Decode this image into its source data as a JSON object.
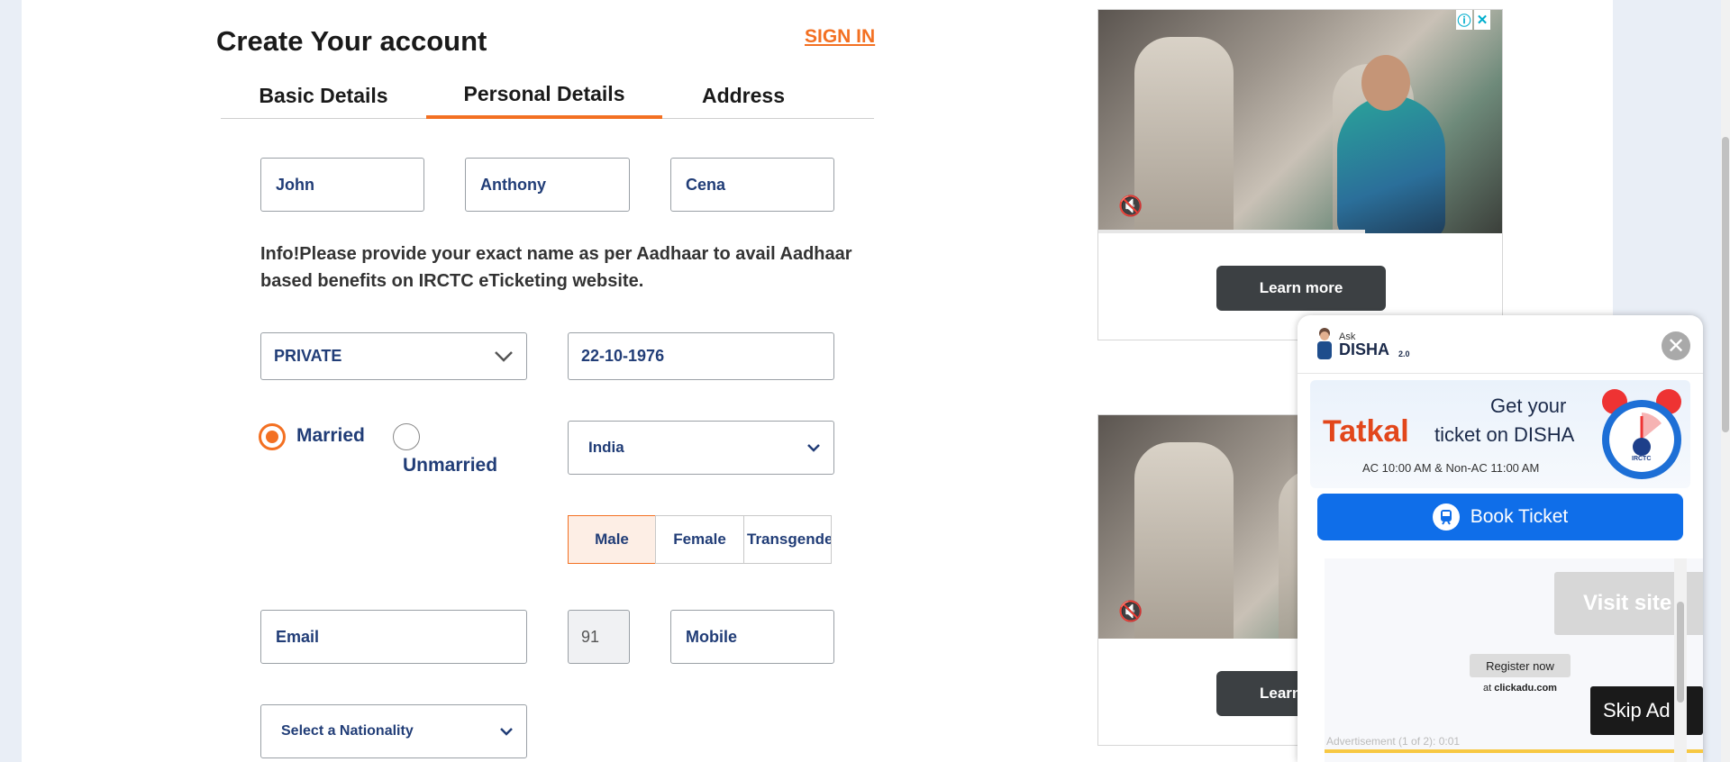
{
  "header": {
    "title": "Create Your account",
    "signin_label": "SIGN IN"
  },
  "tabs": [
    {
      "label": "Basic Details",
      "active": false
    },
    {
      "label": "Personal Details",
      "active": true
    },
    {
      "label": "Address",
      "active": false
    }
  ],
  "name": {
    "first": "John",
    "middle": "Anthony",
    "last": "Cena"
  },
  "info_text": "Info!Please provide your exact name as per Aadhaar to avail Aadhaar based benefits on IRCTC eTicketing website.",
  "occupation": {
    "value": "PRIVATE"
  },
  "dob": {
    "value": "22-10-1976"
  },
  "marital": {
    "married_label": "Married",
    "unmarried_label": "Unmarried",
    "selected": "Married"
  },
  "country": {
    "value": "India"
  },
  "gender": {
    "options": [
      "Male",
      "Female",
      "Transgender"
    ],
    "selected": "Male"
  },
  "contact": {
    "email_placeholder": "Email",
    "isd_code": "91",
    "mobile_placeholder": "Mobile"
  },
  "nationality": {
    "value": "Select a Nationality"
  },
  "ads": {
    "learn_more_label": "Learn more",
    "learn_more_label_partial": "Learn",
    "info_icon": "info-icon",
    "close_icon": "close-icon"
  },
  "disha": {
    "ask_label": "Ask",
    "name": "DISHA",
    "version": "2.0",
    "banner_get_your": "Get your",
    "banner_tatkal": "Tatkal",
    "banner_ticket_on": "ticket on DISHA",
    "banner_timing": "AC 10:00 AM & Non-AC 11:00 AM",
    "banner_brand": "IRCTC",
    "book_label": "Book Ticket",
    "ad": {
      "visit_label": "Visit site",
      "register_label": "Register now",
      "register_at": "at",
      "register_site": "clickadu.com",
      "skip_label": "Skip Ad",
      "adv_label": "Advertisement (1 of 2): 0:01"
    }
  },
  "colors": {
    "accent": "#f37022",
    "input_text": "#213d77",
    "book_button": "#0f6ee9"
  }
}
